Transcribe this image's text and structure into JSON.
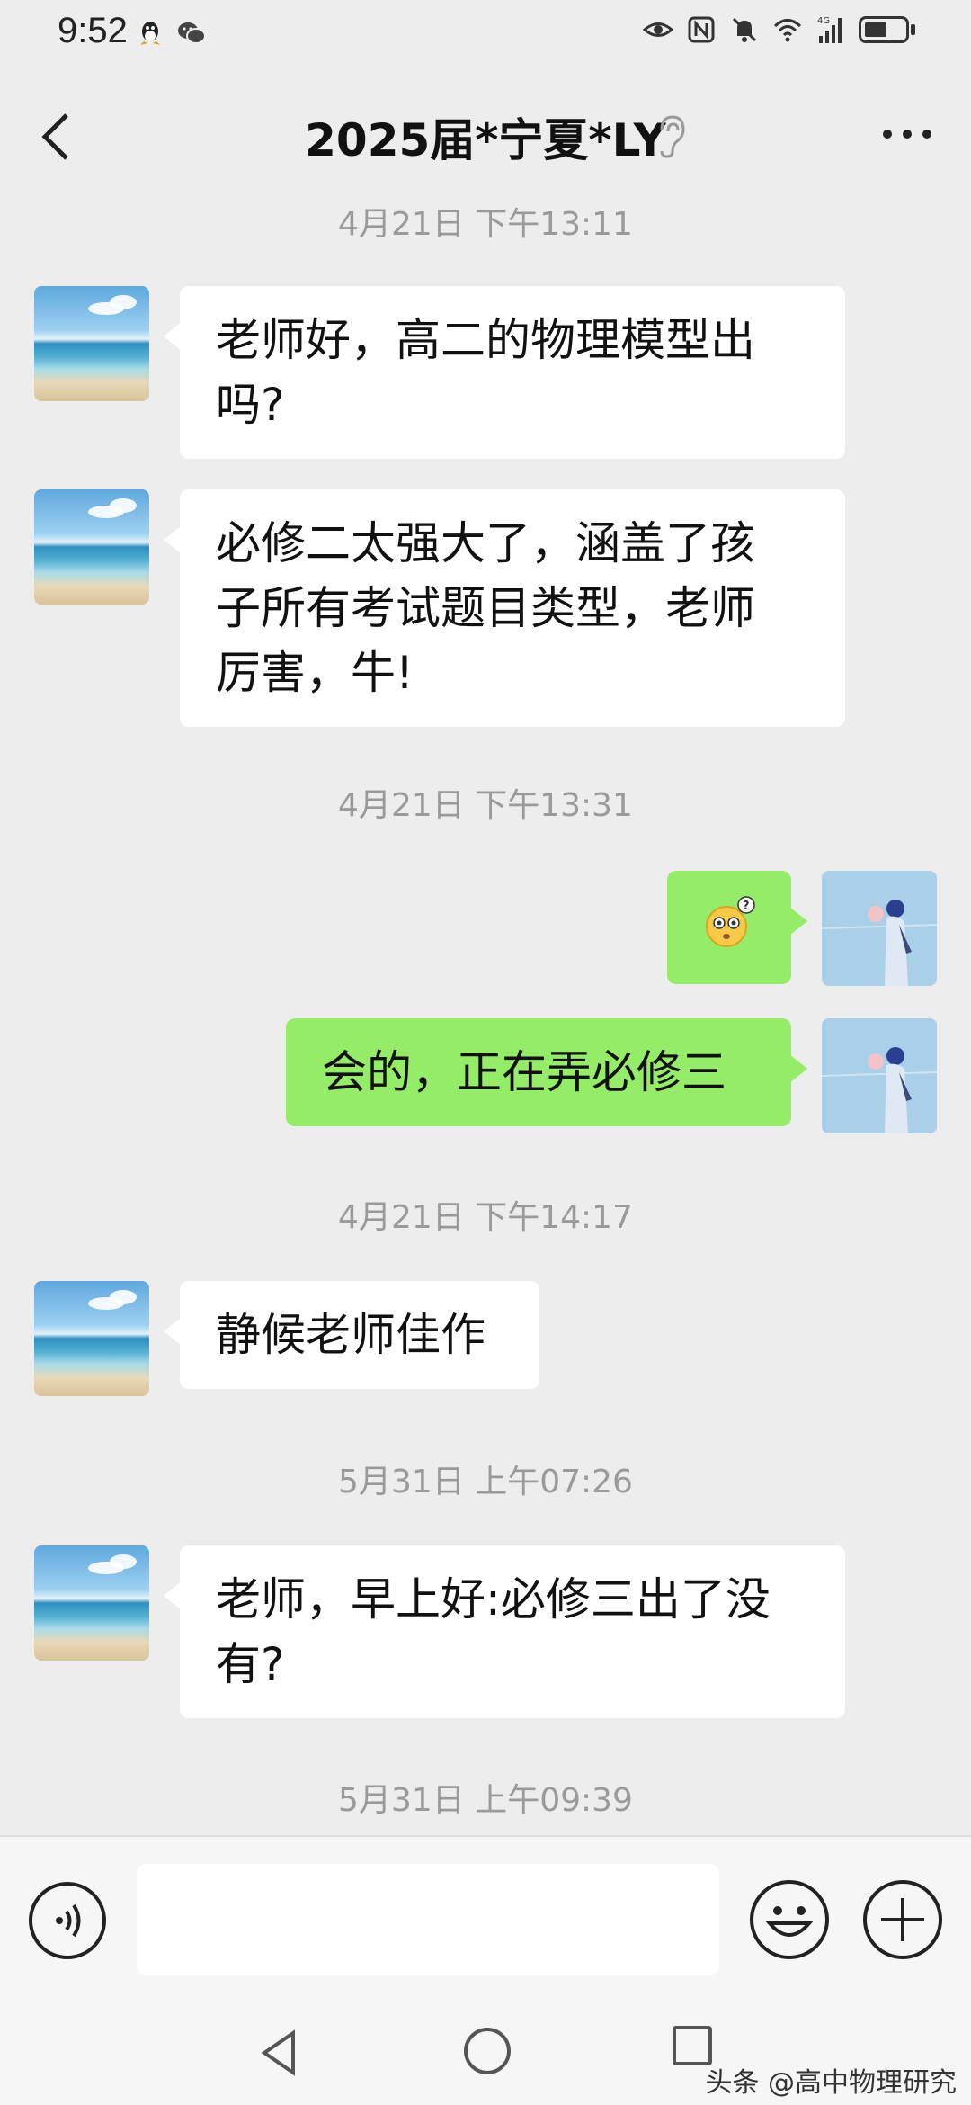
{
  "status_bar": {
    "time": "9:52",
    "network": "4G"
  },
  "header": {
    "title": "2025届*宁夏*LY"
  },
  "messages": [
    {
      "type": "timestamp",
      "text": "4月21日 下午13:11"
    },
    {
      "type": "received",
      "lines": [
        "老师好，高二的物理模型出",
        "吗?"
      ]
    },
    {
      "type": "received",
      "lines": [
        "必修二太强大了，涵盖了孩",
        "子所有考试题目类型，老师",
        "厉害，牛!"
      ]
    },
    {
      "type": "timestamp",
      "text": "4月21日 下午13:31"
    },
    {
      "type": "sent",
      "emoji": "😳"
    },
    {
      "type": "sent",
      "text": "会的，正在弄必修三"
    },
    {
      "type": "timestamp",
      "text": "4月21日 下午14:17"
    },
    {
      "type": "received",
      "text": "静候老师佳作"
    },
    {
      "type": "timestamp",
      "text": "5月31日 上午07:26"
    },
    {
      "type": "received",
      "lines": [
        "老师，早上好:必修三出了没",
        "有?"
      ]
    },
    {
      "type": "timestamp",
      "text": "5月31日 上午09:39"
    }
  ],
  "input": {
    "value": "",
    "placeholder": ""
  },
  "watermark": "头条 @高中物理研究",
  "colors": {
    "background": "#ededed",
    "received_bubble": "#ffffff",
    "sent_bubble": "#95ec69",
    "timestamp": "#9a9a9a"
  }
}
